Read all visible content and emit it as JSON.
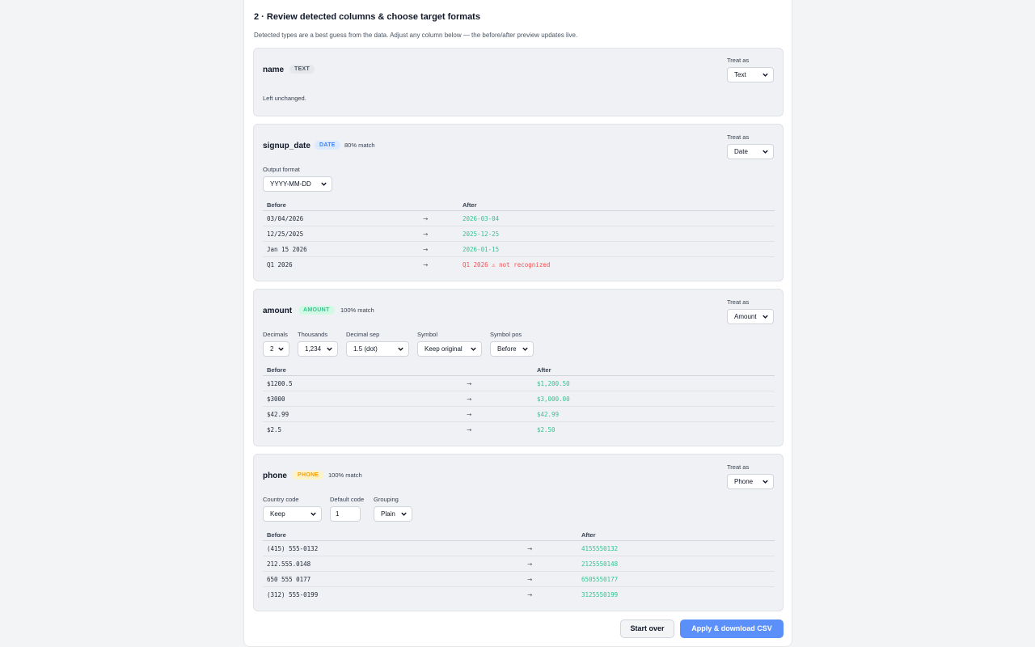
{
  "header": {
    "title": "2 · Review detected columns & choose target formats",
    "description": "Detected types are a best guess from the data. Adjust any column below — the before/after preview updates live."
  },
  "treat_as_label": "Treat as",
  "preview_headers": {
    "before": "Before",
    "after": "After"
  },
  "arrow": "→",
  "columns": {
    "name": {
      "name": "name",
      "badge": "TEXT",
      "treat_as": "Text",
      "note": "Left unchanged."
    },
    "signup_date": {
      "name": "signup_date",
      "badge": "DATE",
      "match": "80% match",
      "treat_as": "Date",
      "output_format_label": "Output format",
      "output_format": "YYYY-MM-DD",
      "rows": [
        {
          "before": "03/04/2026",
          "after": "2026-03-04",
          "status": "ok"
        },
        {
          "before": "12/25/2025",
          "after": "2025-12-25",
          "status": "ok"
        },
        {
          "before": "Jan 15 2026",
          "after": "2026-01-15",
          "status": "ok"
        },
        {
          "before": "Q1 2026",
          "after": "Q1 2026 ⚠ not recognized",
          "status": "error"
        }
      ]
    },
    "amount": {
      "name": "amount",
      "badge": "AMOUNT",
      "match": "100% match",
      "treat_as": "Amount",
      "controls": {
        "decimals": {
          "label": "Decimals",
          "value": "2"
        },
        "thousands": {
          "label": "Thousands",
          "value": "1,234"
        },
        "decimal_sep": {
          "label": "Decimal sep",
          "value": "1.5 (dot)"
        },
        "symbol": {
          "label": "Symbol",
          "value": "Keep original"
        },
        "symbol_pos": {
          "label": "Symbol pos",
          "value": "Before"
        }
      },
      "rows": [
        {
          "before": "$1200.5",
          "after": "$1,200.50",
          "status": "ok"
        },
        {
          "before": "$3000",
          "after": "$3,000.00",
          "status": "ok"
        },
        {
          "before": "$42.99",
          "after": "$42.99",
          "status": "ok"
        },
        {
          "before": "$2.5",
          "after": "$2.50",
          "status": "ok"
        }
      ]
    },
    "phone": {
      "name": "phone",
      "badge": "PHONE",
      "match": "100% match",
      "treat_as": "Phone",
      "controls": {
        "country_code": {
          "label": "Country code",
          "value": "Keep"
        },
        "default_code": {
          "label": "Default code",
          "value": "1"
        },
        "grouping": {
          "label": "Grouping",
          "value": "Plain"
        }
      },
      "rows": [
        {
          "before": "(415) 555-0132",
          "after": "4155550132",
          "status": "ok"
        },
        {
          "before": "212.555.0148",
          "after": "2125550148",
          "status": "ok"
        },
        {
          "before": "650 555 0177",
          "after": "6505550177",
          "status": "ok"
        },
        {
          "before": "(312) 555-0199",
          "after": "3125550199",
          "status": "ok"
        }
      ]
    }
  },
  "buttons": {
    "start_over": "Start over",
    "apply": "Apply & download CSV"
  },
  "colors": {
    "text_badge_bg": "#e5e7eb",
    "text_badge_fg": "#4b5563",
    "date_badge_bg": "#dbeafe",
    "date_badge_fg": "#3b82f6",
    "amount_badge_bg": "#d1fae5",
    "amount_badge_fg": "#34c38f",
    "phone_badge_bg": "#fef3c7",
    "phone_badge_fg": "#f59e0b",
    "ok": "#34c38f",
    "error": "#f05252",
    "primary": "#5b8ff9"
  }
}
